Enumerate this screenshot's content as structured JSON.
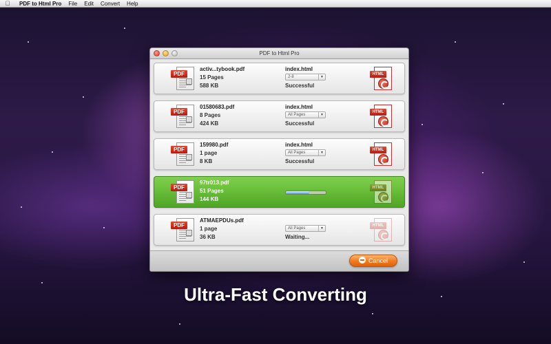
{
  "menubar": {
    "apple_icon": "apple-icon",
    "app_name": "PDF to Html Pro",
    "items": [
      "File",
      "Edit",
      "Convert",
      "Help"
    ]
  },
  "window": {
    "title": "PDF to Html Pro"
  },
  "files": [
    {
      "name": "activ...tybook.pdf",
      "pages": "15 Pages",
      "size": "588 KB",
      "output": "index.html",
      "page_range": "2-8",
      "status": "Successful"
    },
    {
      "name": "01580683.pdf",
      "pages": "8 Pages",
      "size": "424 KB",
      "output": "index.html",
      "page_range": "All Pages",
      "status": "Successful"
    },
    {
      "name": "159980.pdf",
      "pages": "1 page",
      "size": "8 KB",
      "output": "index.html",
      "page_range": "All Pages",
      "status": "Successful"
    },
    {
      "name": "97tr013.pdf",
      "pages": "51 Pages",
      "size": "144 KB",
      "progress": 0.58
    },
    {
      "name": "ATMAEPDUs.pdf",
      "pages": "1 page",
      "size": "36 KB",
      "page_range": "All Pages",
      "status": "Waiting..."
    }
  ],
  "icons": {
    "pdf_label": "PDF",
    "html_label": "HTML"
  },
  "cancel_label": "Cancel",
  "headline": "Ultra-Fast Converting",
  "colors": {
    "active_row": "#5cb52f",
    "cancel_button": "#f07a1d",
    "pdf_badge": "#d32f1f"
  }
}
